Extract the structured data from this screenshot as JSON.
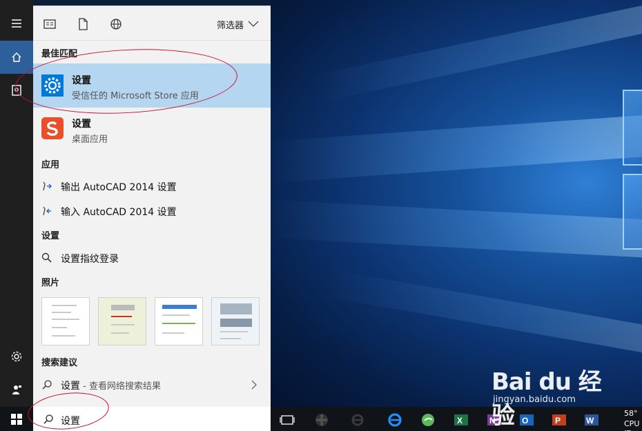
{
  "filter_bar": {
    "filter_label": "筛选器"
  },
  "best_match": {
    "title": "最佳匹配",
    "item": {
      "name": "设置",
      "subtitle": "受信任的 Microsoft Store 应用"
    }
  },
  "second_match": {
    "name": "设置",
    "subtitle": "桌面应用"
  },
  "apps_section": {
    "title": "应用",
    "items": [
      {
        "label": "输出 AutoCAD 2014 设置"
      },
      {
        "label": "输入 AutoCAD 2014 设置"
      }
    ]
  },
  "settings_section": {
    "title": "设置",
    "items": [
      {
        "label": "设置指纹登录"
      }
    ]
  },
  "photos_section": {
    "title": "照片",
    "thumbnail_count": 4
  },
  "suggestions_section": {
    "title": "搜索建议",
    "item": {
      "label": "设置",
      "sub": " - 查看网络搜索结果"
    }
  },
  "search": {
    "query": "设置"
  },
  "clock": {
    "line1": "58°",
    "line2": "CPU温"
  },
  "watermark": {
    "brand": "Bai du 经验",
    "url": "jingyan.baidu.com"
  },
  "colors": {
    "accent": "#0078d7",
    "selected_bg": "#b5d6f1",
    "annotation": "#c8102e"
  }
}
